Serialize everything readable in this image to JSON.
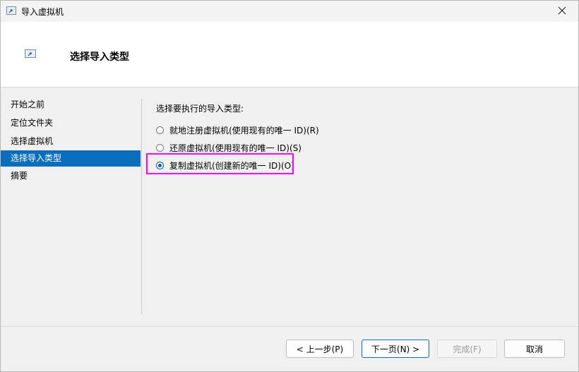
{
  "window": {
    "title": "导入虚拟机",
    "icon": "import-arrow-icon",
    "close_icon": "close-icon"
  },
  "header": {
    "title": "选择导入类型",
    "icon": "import-arrow-icon"
  },
  "sidebar": {
    "items": [
      {
        "label": "开始之前",
        "active": false
      },
      {
        "label": "定位文件夹",
        "active": false
      },
      {
        "label": "选择虚拟机",
        "active": false
      },
      {
        "label": "选择导入类型",
        "active": true
      },
      {
        "label": "摘要",
        "active": false
      }
    ]
  },
  "main": {
    "prompt": "选择要执行的导入类型:",
    "options": [
      {
        "label": "就地注册虚拟机(使用现有的唯一 ID)(R)",
        "selected": false
      },
      {
        "label": "还原虚拟机(使用现有的唯一 ID)(S)",
        "selected": false
      },
      {
        "label": "复制虚拟机(创建新的唯一 ID)(O)",
        "selected": true
      }
    ]
  },
  "buttons": {
    "prev": "< 上一步(P)",
    "next": "下一页(N) >",
    "finish": "完成(F)",
    "cancel": "取消"
  },
  "colors": {
    "accent": "#0a6ebd",
    "highlight": "#ff00ff"
  }
}
